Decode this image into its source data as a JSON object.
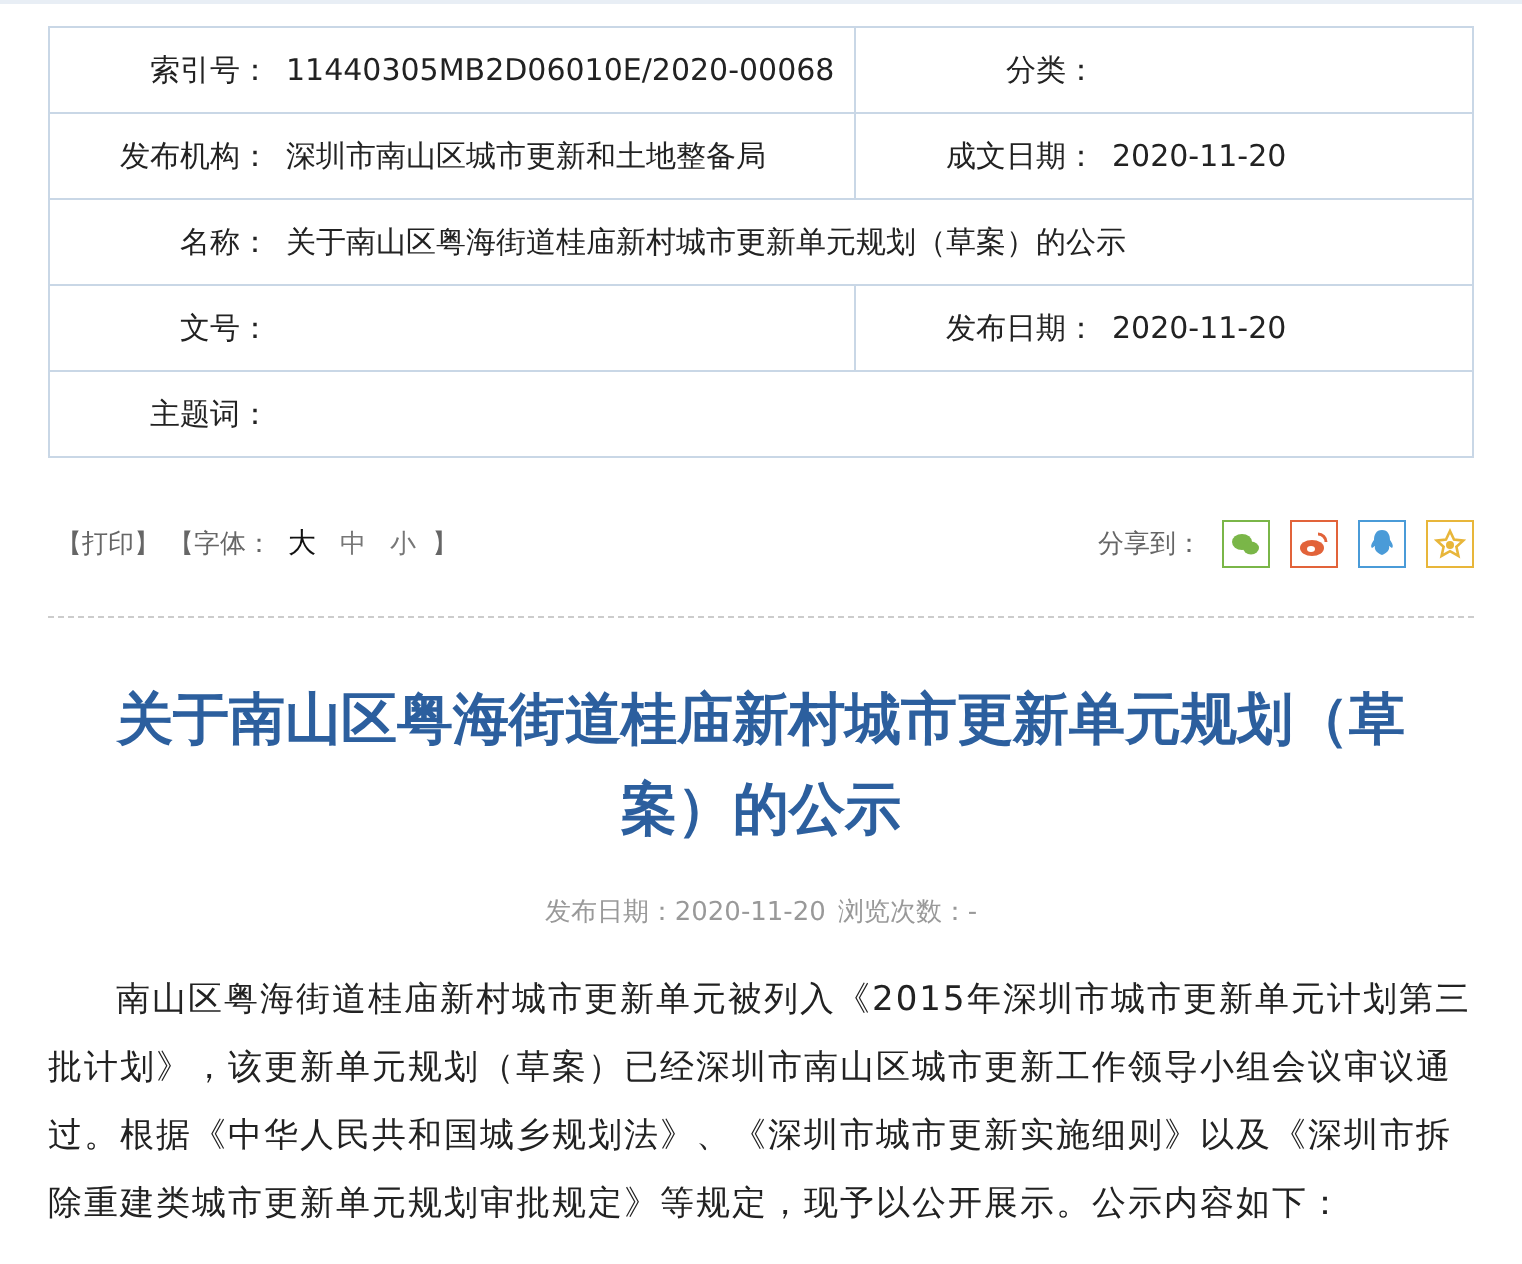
{
  "info_table": {
    "rows": [
      {
        "cells": [
          {
            "label": "索引号：",
            "value": "11440305MB2D06010E/2020-00068"
          },
          {
            "label": "分类："
          }
        ]
      },
      {
        "cells": [
          {
            "label": "发布机构：",
            "value": "深圳市南山区城市更新和土地整备局"
          },
          {
            "label": "成文日期：",
            "value": "2020-11-20"
          }
        ]
      },
      {
        "cells": [
          {
            "label": "名称：",
            "value": "关于南山区粤海街道桂庙新村城市更新单元规划（草案）的公示"
          }
        ]
      },
      {
        "cells": [
          {
            "label": "文号："
          },
          {
            "label": "发布日期：",
            "value": "2020-11-20"
          }
        ]
      },
      {
        "cells": [
          {
            "label": "主题词："
          }
        ]
      }
    ]
  },
  "toolbar": {
    "print": "【打印】",
    "font_label": "【字体：",
    "font_sizes": [
      {
        "label": "大",
        "selected": true
      },
      {
        "label": "中",
        "selected": false
      },
      {
        "label": "小",
        "selected": false
      }
    ],
    "font_end": "】",
    "share_label": "分享到：",
    "share": [
      {
        "kind": "wechat",
        "color": "#7ab648"
      },
      {
        "kind": "weibo",
        "color": "#e2633a"
      },
      {
        "kind": "qq",
        "color": "#4a9bd8"
      },
      {
        "kind": "favorite",
        "color": "#e8b63a"
      }
    ]
  },
  "article": {
    "title": "关于南山区粤海街道桂庙新村城市更新单元规划（草案）的公示",
    "meta_date": "发布日期：2020-11-20",
    "meta_views": "浏览次数：-",
    "paragraph": "南山区粤海街道桂庙新村城市更新单元被列入《2015年深圳市城市更新单元计划第三批计划》，该更新单元规划（草案）已经深圳市南山区城市更新工作领导小组会议审议通过。根据《中华人民共和国城乡规划法》、《深圳市城市更新实施细则》以及《深圳市拆除重建类城市更新单元规划审批规定》等规定，现予以公开展示。公示内容如下："
  }
}
